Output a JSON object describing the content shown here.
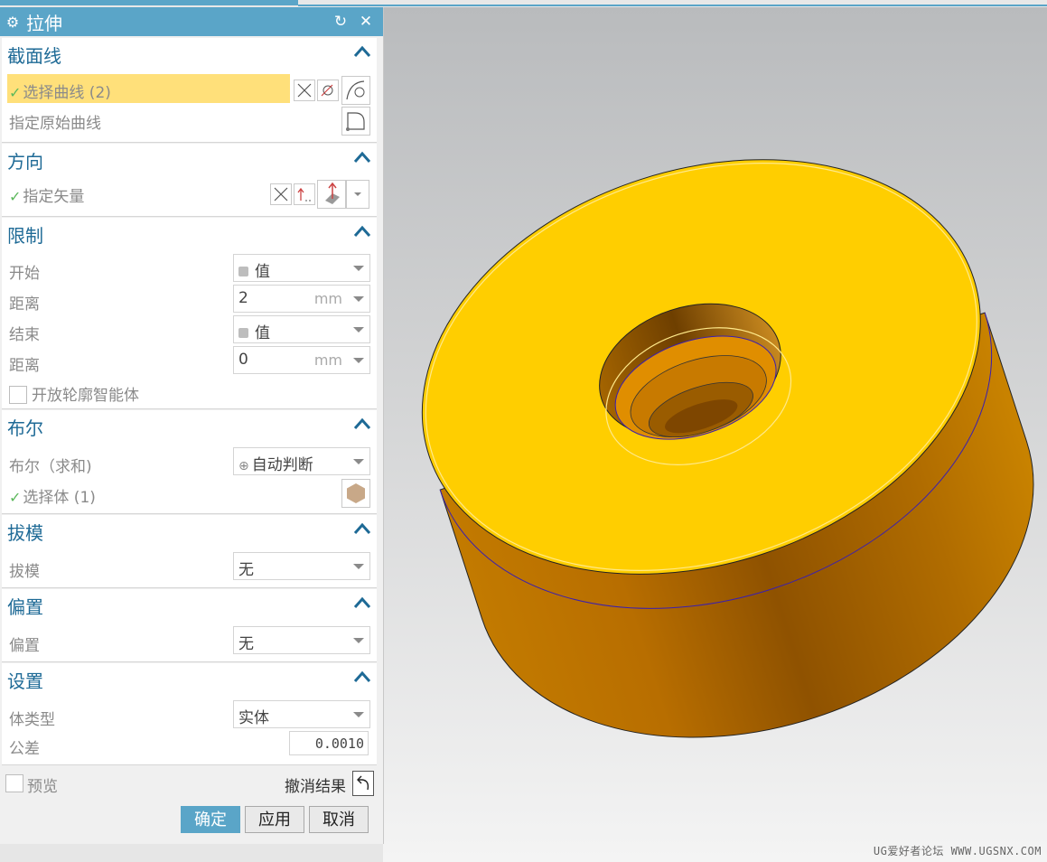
{
  "dialog": {
    "title": "拉伸",
    "icons": {
      "title": "gear-icon",
      "reset": "reset-icon",
      "close": "close-icon"
    },
    "reset_glyph": "↻",
    "close_glyph": "✕"
  },
  "section_curve": {
    "header": "截面线",
    "select_curve": "选择曲线 (2)",
    "origin_curve": "指定原始曲线"
  },
  "direction": {
    "header": "方向",
    "vector": "指定矢量"
  },
  "limits": {
    "header": "限制",
    "start_label": "开始",
    "start_value": "值",
    "dist1_label": "距离",
    "dist1_value": "2",
    "end_label": "结束",
    "end_value": "值",
    "dist2_label": "距离",
    "dist2_value": "0",
    "unit": "mm",
    "open_profile": "开放轮廓智能体"
  },
  "boolean": {
    "header": "布尔",
    "label": "布尔（求和)",
    "value": "自动判断",
    "select_body": "选择体 (1)"
  },
  "draft": {
    "header": "拔模",
    "label": "拔模",
    "value": "无"
  },
  "offset": {
    "header": "偏置",
    "label": "偏置",
    "value": "无"
  },
  "settings": {
    "header": "设置",
    "body_type_label": "体类型",
    "body_type_value": "实体",
    "tolerance_label": "公差",
    "tolerance_value": "0.0010"
  },
  "footer": {
    "preview": "预览",
    "undo_result": "撤消结果",
    "ok": "确定",
    "apply": "应用",
    "cancel": "取消"
  },
  "viewport": {
    "watermark": "UG爱好者论坛 WWW.UGSNX.COM",
    "model": "extruded-ring",
    "colors": {
      "top_face": "#FFD000",
      "side_face": "#C07800",
      "hole": "#8A5200"
    }
  }
}
